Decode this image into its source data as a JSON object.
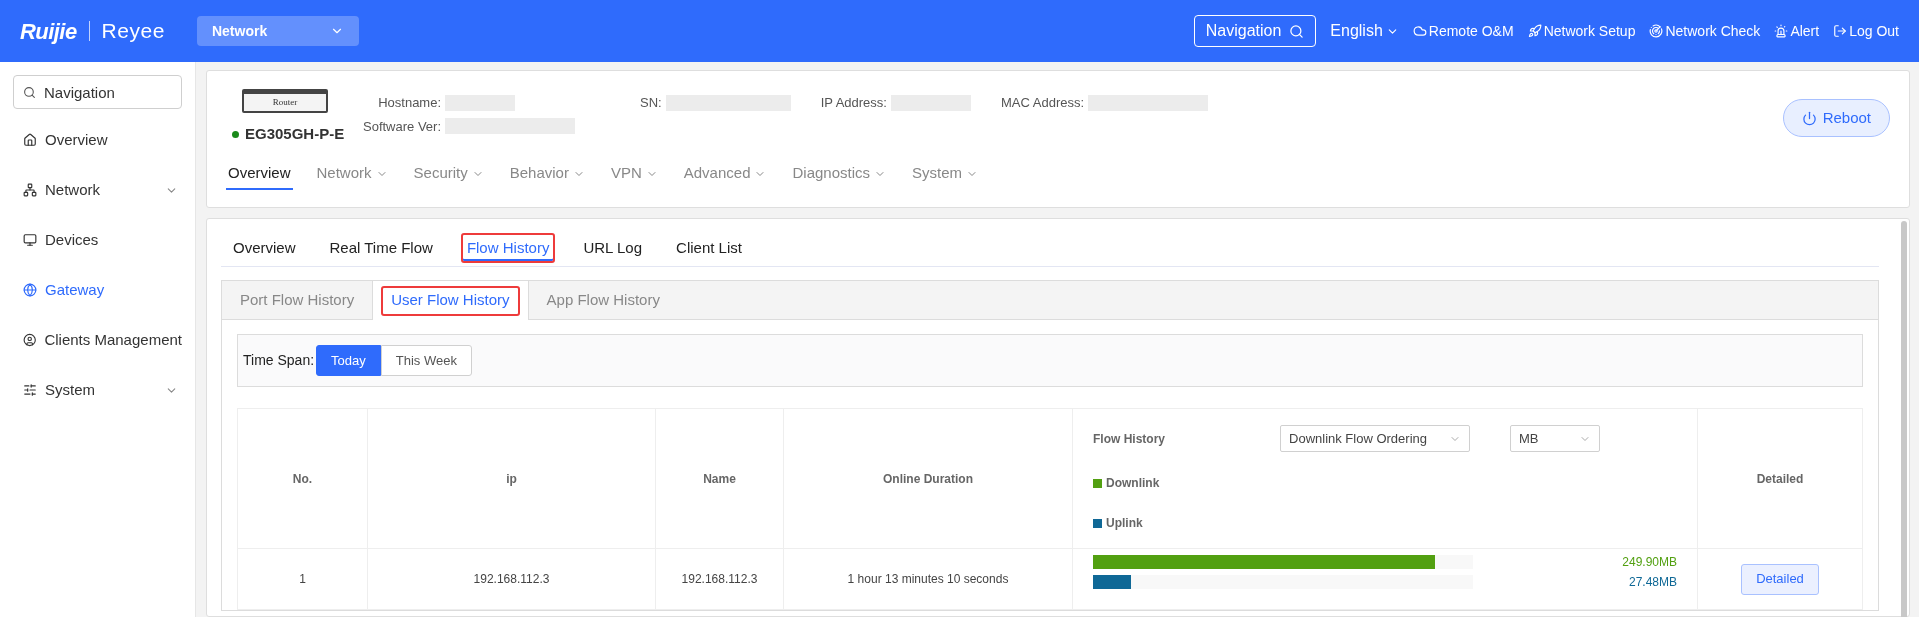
{
  "header": {
    "logo_brand": "Ruijie",
    "logo_product": "Reyee",
    "network_select": {
      "value": "Network"
    },
    "navigation_button": "Navigation",
    "language": "English",
    "actions": [
      {
        "label": "Remote O&M"
      },
      {
        "label": "Network Setup"
      },
      {
        "label": "Network Check"
      },
      {
        "label": "Alert"
      },
      {
        "label": "Log Out"
      }
    ]
  },
  "sidebar": {
    "search": {
      "placeholder": "Navigation"
    },
    "items": [
      {
        "label": "Overview",
        "selected": false,
        "expandable": false
      },
      {
        "label": "Network",
        "selected": false,
        "expandable": true
      },
      {
        "label": "Devices",
        "selected": false,
        "expandable": false
      },
      {
        "label": "Gateway",
        "selected": true,
        "expandable": false
      },
      {
        "label": "Clients Management",
        "selected": false,
        "expandable": false
      },
      {
        "label": "System",
        "selected": false,
        "expandable": true
      }
    ]
  },
  "device": {
    "image_label": "Router",
    "model": "EG305GH-P-E",
    "online": true,
    "fields": [
      {
        "label": "Hostname:"
      },
      {
        "label": "Software Ver:"
      },
      {
        "label": "SN:"
      },
      {
        "label": "IP Address:"
      },
      {
        "label": "MAC Address:"
      }
    ],
    "reboot_button": "Reboot",
    "tabs": [
      {
        "label": "Overview",
        "selected": true,
        "dropdown": false
      },
      {
        "label": "Network",
        "selected": false,
        "dropdown": true
      },
      {
        "label": "Security",
        "selected": false,
        "dropdown": true
      },
      {
        "label": "Behavior",
        "selected": false,
        "dropdown": true
      },
      {
        "label": "VPN",
        "selected": false,
        "dropdown": true
      },
      {
        "label": "Advanced",
        "selected": false,
        "dropdown": true
      },
      {
        "label": "Diagnostics",
        "selected": false,
        "dropdown": true
      },
      {
        "label": "System",
        "selected": false,
        "dropdown": true
      }
    ]
  },
  "content": {
    "tabs": [
      {
        "label": "Overview",
        "selected": false,
        "highlighted": false
      },
      {
        "label": "Real Time Flow",
        "selected": false,
        "highlighted": false
      },
      {
        "label": "Flow History",
        "selected": true,
        "highlighted": true
      },
      {
        "label": "URL Log",
        "selected": false,
        "highlighted": false
      },
      {
        "label": "Client List",
        "selected": false,
        "highlighted": false
      }
    ],
    "sub_tabs": [
      {
        "label": "Port Flow History",
        "selected": false,
        "highlighted": false
      },
      {
        "label": "User Flow History",
        "selected": true,
        "highlighted": true
      },
      {
        "label": "App Flow History",
        "selected": false,
        "highlighted": false
      }
    ],
    "time_span": {
      "label": "Time Span:",
      "options": [
        {
          "label": "Today",
          "selected": true
        },
        {
          "label": "This Week",
          "selected": false
        }
      ]
    },
    "table": {
      "columns": [
        "No.",
        "ip",
        "Name",
        "Online Duration"
      ],
      "flow_column": {
        "title": "Flow History",
        "order_select": "Downlink Flow Ordering",
        "unit_select": "MB",
        "legend": [
          {
            "label": "Downlink",
            "color": "#52a011"
          },
          {
            "label": "Uplink",
            "color": "#0f6896"
          }
        ]
      },
      "detail_column": "Detailed",
      "rows": [
        {
          "cells": [
            "1",
            "192.168.112.3",
            "192.168.112.3",
            "1 hour 13 minutes 10 seconds"
          ],
          "flows": [
            {
              "level": 0.9,
              "reading": "249.90MB"
            },
            {
              "level": 0.1,
              "reading": "27.48MB"
            }
          ],
          "button": "Detailed"
        }
      ]
    }
  }
}
